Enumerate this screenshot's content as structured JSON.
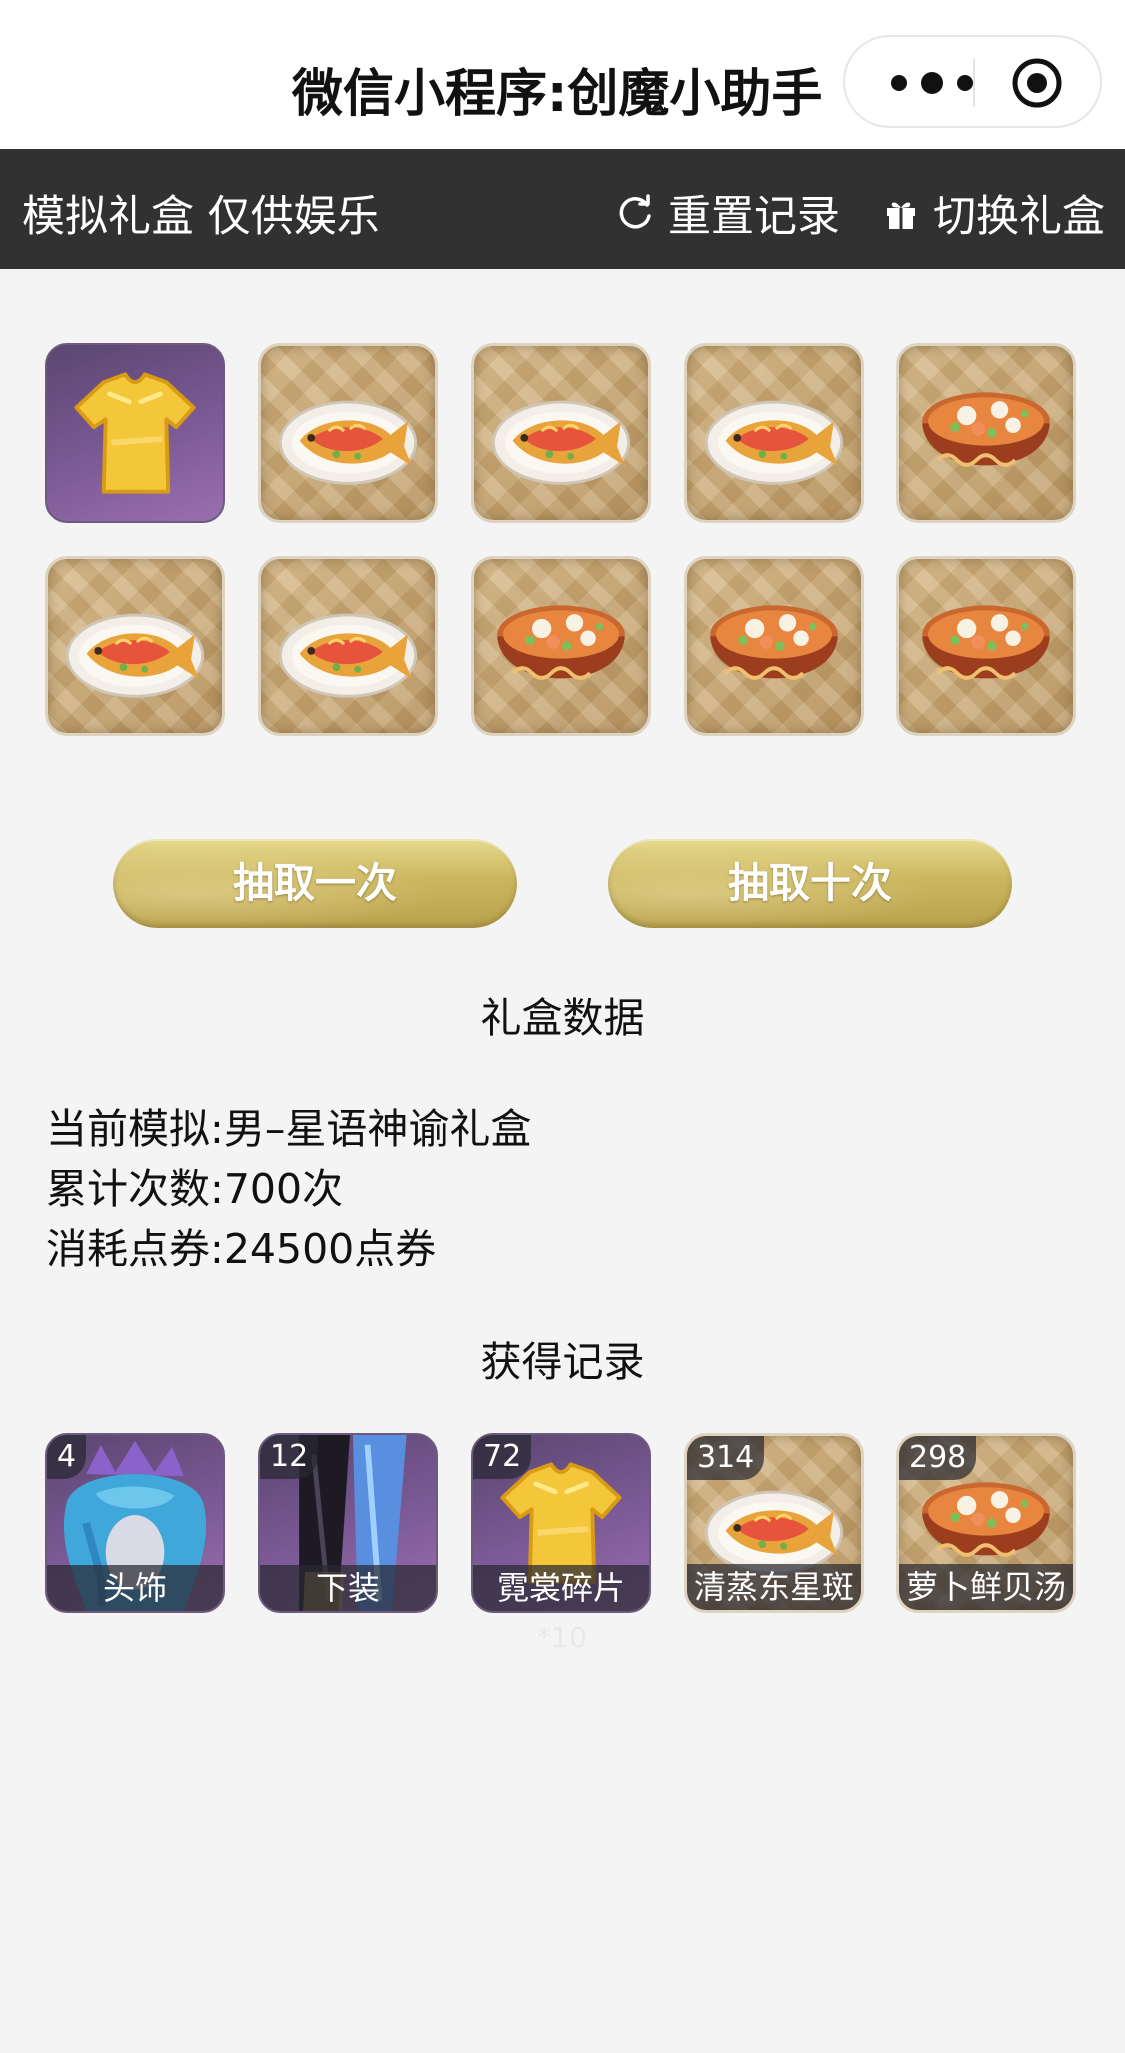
{
  "app": {
    "title": "微信小程序:创魔小助手",
    "capsule_icons": [
      "more-dots-icon",
      "target-circle-icon"
    ]
  },
  "toolbar": {
    "notice": "模拟礼盒 仅供娱乐",
    "reset_label": "重置记录",
    "reset_icon": "refresh-icon",
    "switch_label": "切换礼盒",
    "switch_icon": "gift-icon"
  },
  "draw_results": [
    {
      "item": "tshirt",
      "frame": "purple"
    },
    {
      "item": "fish",
      "frame": "wood"
    },
    {
      "item": "fish",
      "frame": "wood"
    },
    {
      "item": "fish",
      "frame": "wood"
    },
    {
      "item": "soup",
      "frame": "wood"
    },
    {
      "item": "fish",
      "frame": "wood"
    },
    {
      "item": "fish",
      "frame": "wood"
    },
    {
      "item": "soup",
      "frame": "wood"
    },
    {
      "item": "soup",
      "frame": "wood"
    },
    {
      "item": "soup",
      "frame": "wood"
    }
  ],
  "buttons": {
    "draw_once": "抽取一次",
    "draw_ten": "抽取十次"
  },
  "stats": {
    "title": "礼盒数据",
    "current_label": "当前模拟:",
    "current_value": "男–星语神谕礼盒",
    "count_label": "累计次数:",
    "count_value": "700次",
    "cost_label": "消耗点券:",
    "cost_value": "24500点券"
  },
  "records": {
    "title": "获得记录",
    "items": [
      {
        "count": "4",
        "name": "头饰",
        "art": "headwear"
      },
      {
        "count": "12",
        "name": "下装",
        "art": "pants"
      },
      {
        "count": "72",
        "name": "霓裳碎片",
        "art": "tshirt"
      },
      {
        "count": "314",
        "name": "清蒸东星斑",
        "art": "fish"
      },
      {
        "count": "298",
        "name": "萝卜鲜贝汤",
        "art": "soup"
      }
    ],
    "footnote": "*10"
  },
  "colors": {
    "toolbar_bg": "#313131",
    "page_bg": "#f4f4f4",
    "button_gold": "#cbb65e",
    "rare_frame": "#7c5a96"
  }
}
